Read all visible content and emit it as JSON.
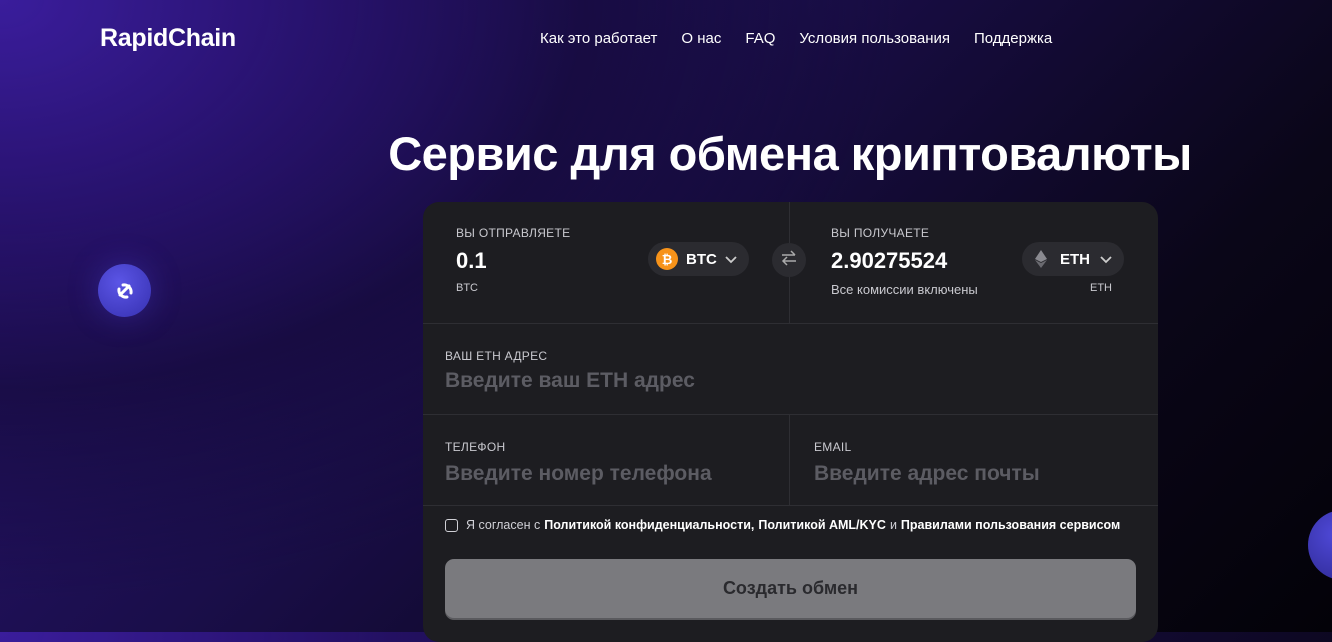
{
  "header": {
    "logo": "RapidChain",
    "nav": [
      "Как это работает",
      "О нас",
      "FAQ",
      "Условия пользования",
      "Поддержка"
    ]
  },
  "hero": {
    "title": "Сервис для обмена криптовалюты"
  },
  "exchange": {
    "send": {
      "label": "ВЫ ОТПРАВЛЯЕТЕ",
      "amount": "0.1",
      "currency_note": "BTC",
      "selector": "BTC",
      "selector_icon": "bitcoin-icon"
    },
    "receive": {
      "label": "ВЫ ПОЛУЧАЕТЕ",
      "amount": "2.90275524",
      "note": "Все комиссии включены",
      "currency_note": "ETH",
      "selector": "ETH",
      "selector_icon": "ethereum-icon"
    },
    "swap_icon": "swap-arrows-icon"
  },
  "form": {
    "address": {
      "label": "ВАШ ETH АДРЕС",
      "placeholder": "Введите ваш ETH адрес"
    },
    "phone": {
      "label": "ТЕЛЕФОН",
      "placeholder": "Введите номер телефона"
    },
    "email": {
      "label": "EMAIL",
      "placeholder": "Введите адрес почты"
    },
    "consent": {
      "prefix": "Я согласен с",
      "privacy": "Политикой конфиденциальности,",
      "aml": "Политикой AML/KYC",
      "and": "и",
      "rules": "Правилами пользования сервисом"
    },
    "submit": "Создать обмен"
  },
  "colors": {
    "accent": "#3a1d9c",
    "card": "#1d1d21",
    "btc": "#f7931a",
    "button": "#7a7a7e"
  }
}
